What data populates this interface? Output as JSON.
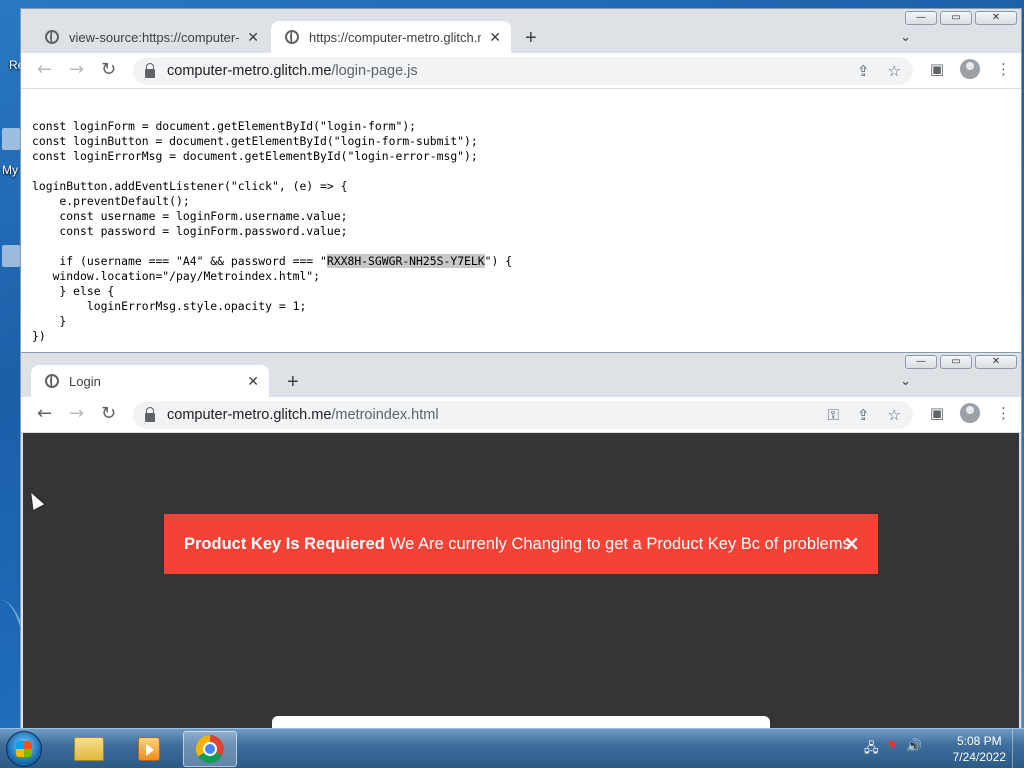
{
  "desktop": {
    "peek_labels": [
      "Re",
      "My"
    ]
  },
  "window1": {
    "tabs": [
      {
        "title": "view-source:https://computer-m",
        "active": false
      },
      {
        "title": "https://computer-metro.glitch.m",
        "active": true
      }
    ],
    "url_host": "computer-metro.glitch.me",
    "url_path": "/login-page.js",
    "source_lines": [
      "const loginForm = document.getElementById(\"login-form\");",
      "const loginButton = document.getElementById(\"login-form-submit\");",
      "const loginErrorMsg = document.getElementById(\"login-error-msg\");",
      "",
      "loginButton.addEventListener(\"click\", (e) => {",
      "    e.preventDefault();",
      "    const username = loginForm.username.value;",
      "    const password = loginForm.password.value;",
      "",
      "    if (username === \"A4\" && password === \"",
      "   window.location=\"/pay/Metroindex.html\";",
      "    } else {",
      "        loginErrorMsg.style.opacity = 1;",
      "    }",
      "})"
    ],
    "highlighted_key": "RXX8H-SGWGR-NH25S-Y7ELK",
    "after_key": "\") {"
  },
  "window2": {
    "tabs": [
      {
        "title": "Login",
        "active": true
      }
    ],
    "url_host": "computer-metro.glitch.me",
    "url_path": "/metroindex.html",
    "alert": {
      "bold": "Product Key Is Requiered",
      "text": "We Are currenly Changing to get a Product Key Bc of problems",
      "close": "×"
    }
  },
  "icons": {
    "back": "←",
    "forward": "→",
    "reload": "↻",
    "close_tab": "✕",
    "new_tab": "+",
    "tab_dropdown": "⌄",
    "share": "⇪",
    "star": "☆",
    "sidepanel": "▣",
    "menu": "⋮",
    "key": "⚿"
  },
  "caption_buttons": {
    "min": "—",
    "max": "▭",
    "close": "✕"
  },
  "taskbar": {
    "time": "5:08 PM",
    "date": "7/24/2022"
  },
  "colors": {
    "alert_bg": "#f44336",
    "page_bg": "#353535",
    "desktop_blue": "#1b5fa8"
  }
}
